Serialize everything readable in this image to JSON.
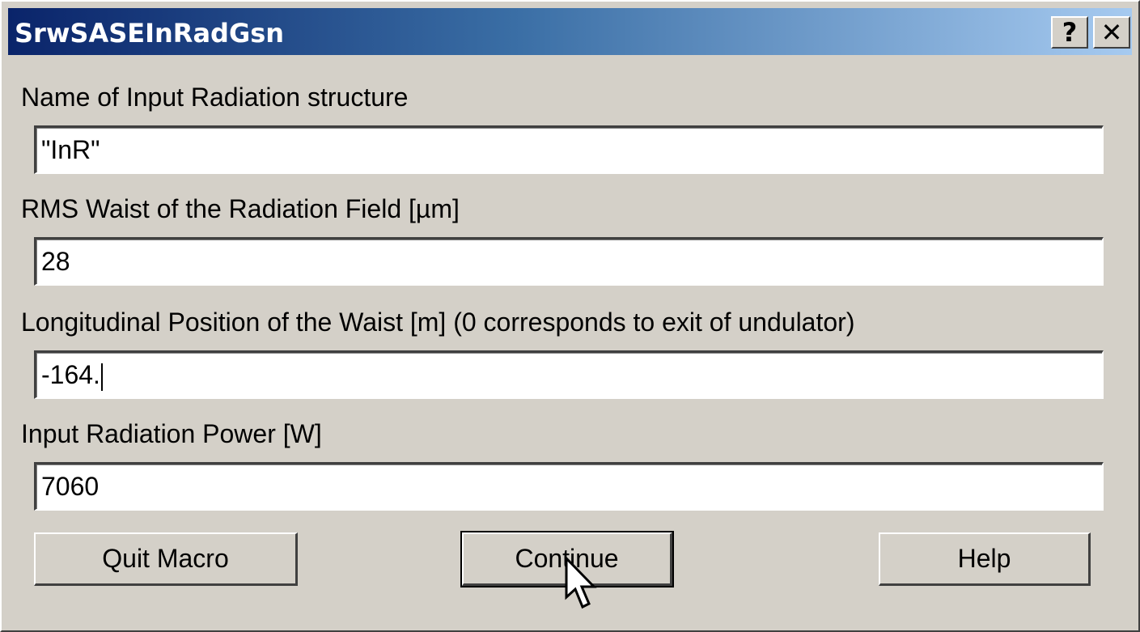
{
  "window": {
    "title": "SrwSASEInRadGsn"
  },
  "titlebar_buttons": {
    "help": "?",
    "close": "✕"
  },
  "fields": [
    {
      "label": "Name of Input Radiation structure",
      "value": "\"InR\""
    },
    {
      "label": "RMS Waist of the Radiation Field [µm]",
      "value": "28"
    },
    {
      "label": "Longitudinal Position of the Waist [m] (0 corresponds to exit of undulator)",
      "value": "-164."
    },
    {
      "label": "Input Radiation Power [W]",
      "value": "7060"
    }
  ],
  "buttons": {
    "quit": "Quit Macro",
    "continue": "Continue",
    "help": "Help"
  },
  "icons": {
    "cursor": "arrow-cursor-icon"
  },
  "colors": {
    "titlebar_start": "#0a246a",
    "titlebar_end": "#a6caf0",
    "face": "#d4d0c8"
  }
}
